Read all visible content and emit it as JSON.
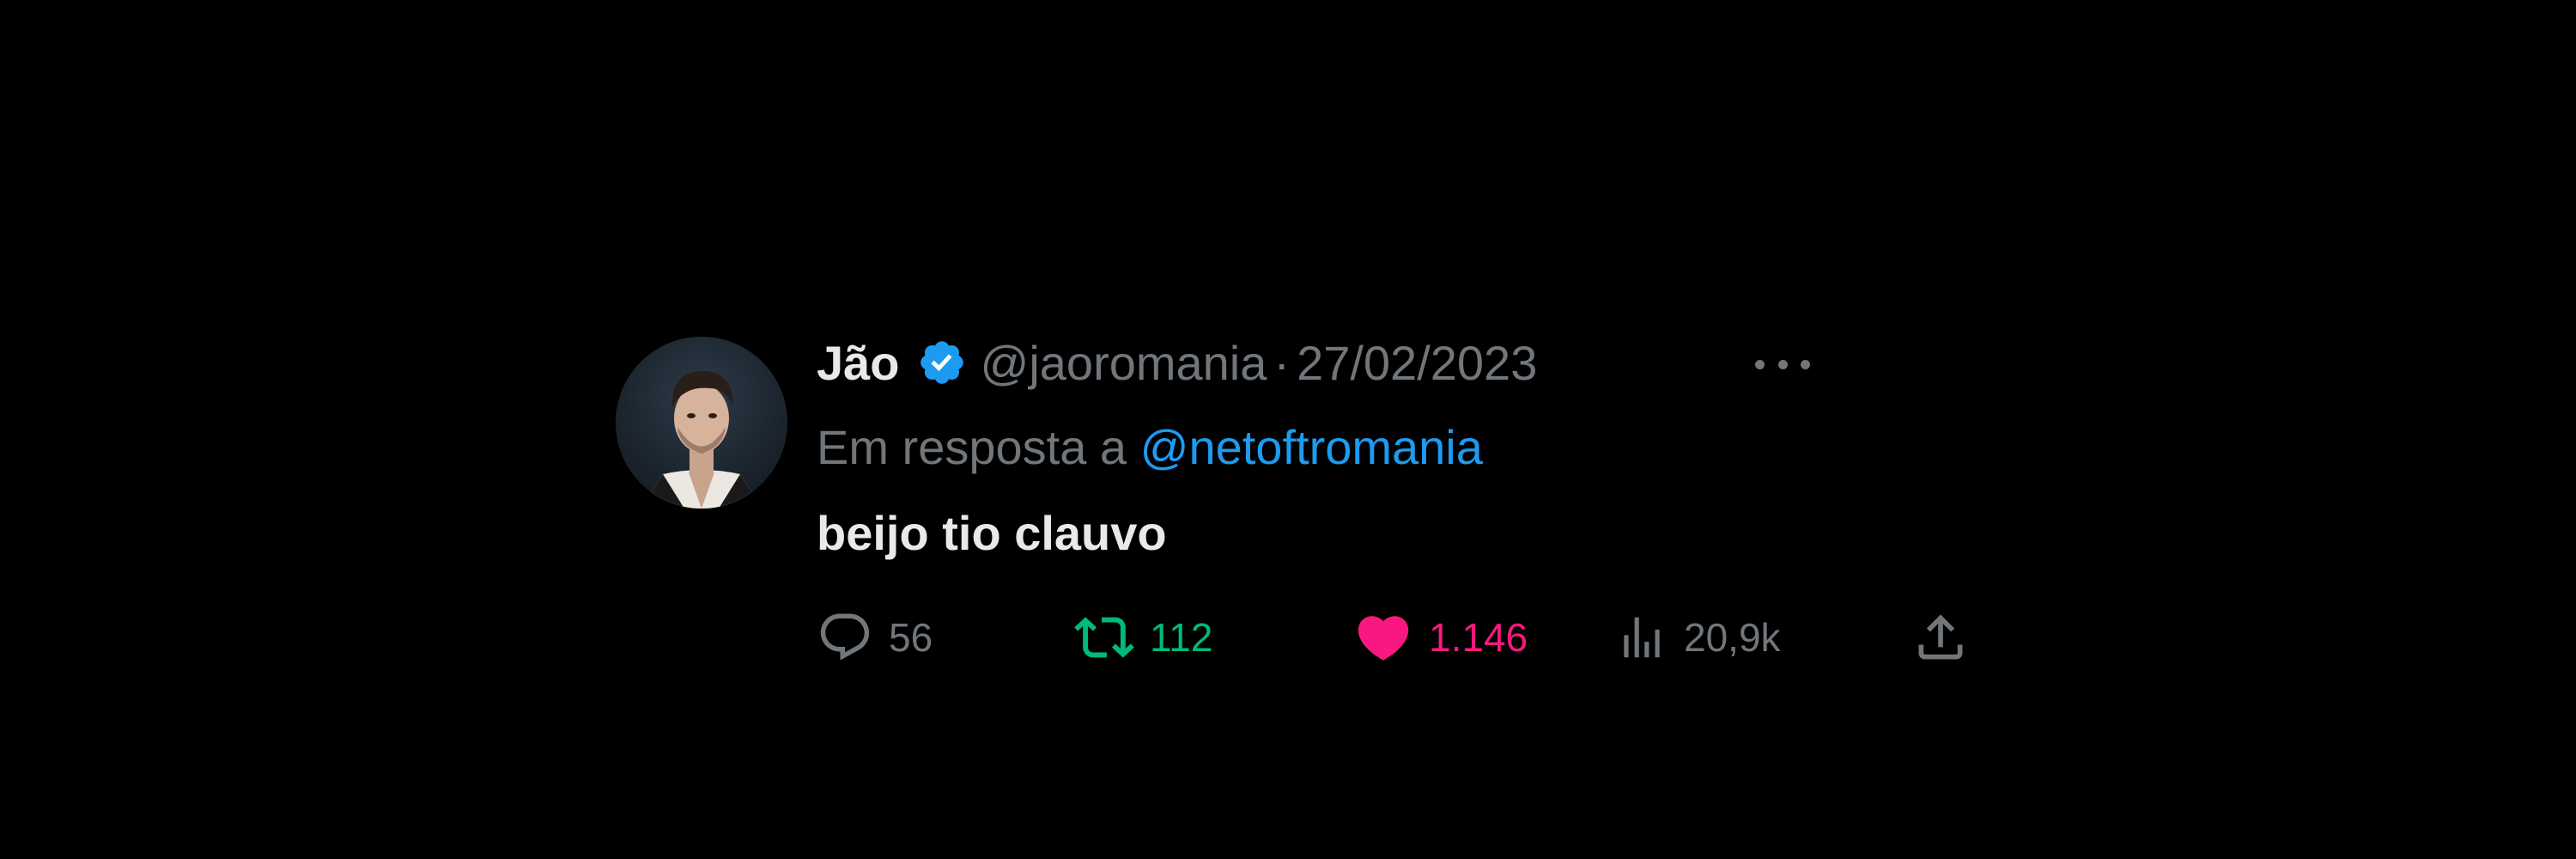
{
  "tweet": {
    "author_name": "Jão",
    "handle": "@jaoromania",
    "separator": "·",
    "date": "27/02/2023",
    "reply_prefix": "Em resposta a",
    "reply_to": "@netoftromania",
    "text": "beijo tio clauvo",
    "stats": {
      "replies": "56",
      "retweets": "112",
      "likes": "1.146",
      "views": "20,9k"
    }
  },
  "icons": {
    "verified": "verified-badge-icon",
    "more": "more-options-icon",
    "reply": "reply-icon",
    "retweet": "retweet-icon",
    "like": "heart-icon",
    "views": "views-icon",
    "share": "share-icon"
  },
  "colors": {
    "background": "#000000",
    "text_primary": "#e7e9ea",
    "text_secondary": "#71767b",
    "link": "#1d9bf0",
    "verified": "#1d9bf0",
    "retweet_active": "#00ba7c",
    "like_active": "#f91880"
  }
}
